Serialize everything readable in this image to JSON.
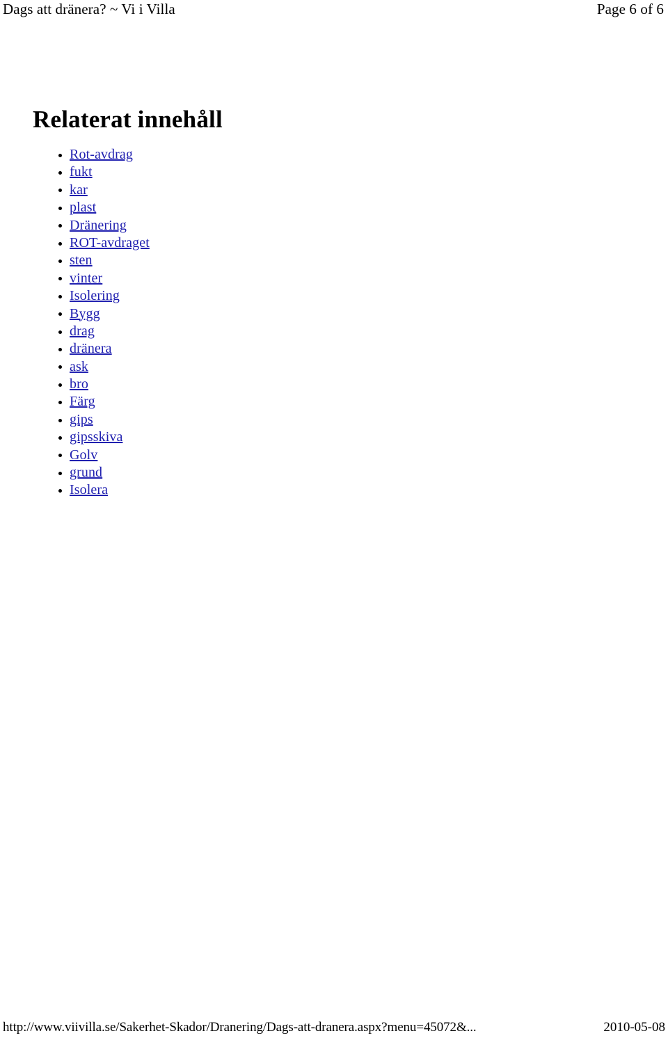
{
  "header": {
    "document_title": "Dags att dränera? ~ Vi i Villa",
    "page_indicator": "Page 6 of 6"
  },
  "main": {
    "section_heading": "Relaterat innehåll",
    "related_links": [
      {
        "label": "Rot-avdrag"
      },
      {
        "label": "fukt"
      },
      {
        "label": "kar"
      },
      {
        "label": "plast"
      },
      {
        "label": "Dränering"
      },
      {
        "label": "ROT-avdraget"
      },
      {
        "label": "sten"
      },
      {
        "label": "vinter"
      },
      {
        "label": "Isolering"
      },
      {
        "label": "Bygg"
      },
      {
        "label": "drag"
      },
      {
        "label": "dränera"
      },
      {
        "label": "ask"
      },
      {
        "label": "bro"
      },
      {
        "label": "Färg"
      },
      {
        "label": "gips"
      },
      {
        "label": "gipsskiva"
      },
      {
        "label": "Golv"
      },
      {
        "label": "grund"
      },
      {
        "label": "Isolera"
      }
    ]
  },
  "footer": {
    "url": "http://www.viivilla.se/Sakerhet-Skador/Dranering/Dags-att-dranera.aspx?menu=45072&...",
    "date": "2010-05-08"
  },
  "colors": {
    "link": "#2020B0",
    "text": "#000000",
    "background": "#FFFFFF",
    "bullet": "#000000"
  }
}
